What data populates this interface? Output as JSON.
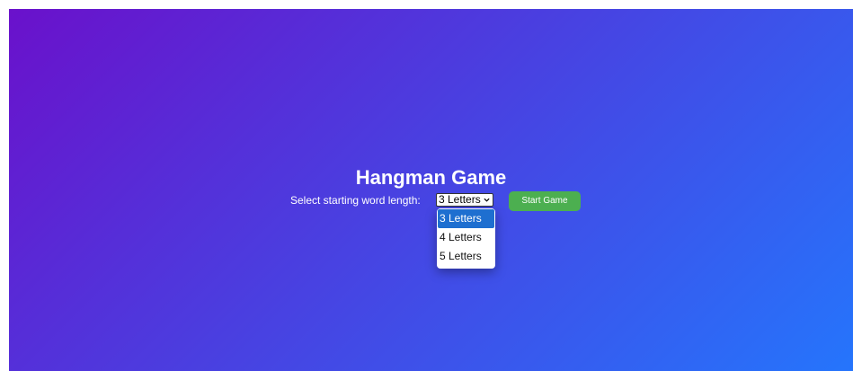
{
  "game": {
    "title": "Hangman Game",
    "select_label": "Select starting word length:",
    "selected_option": "3 Letters",
    "start_button_label": "Start Game"
  },
  "dropdown": {
    "options": [
      {
        "label": "3 Letters",
        "selected": true
      },
      {
        "label": "4 Letters",
        "selected": false
      },
      {
        "label": "5 Letters",
        "selected": false
      }
    ]
  },
  "colors": {
    "gradient_start": "#6a11cb",
    "gradient_end": "#2575fc",
    "button": "#4caf50",
    "option_highlight": "#1e6fd0"
  },
  "icons": {
    "select_arrow": "chevron-down-icon"
  }
}
